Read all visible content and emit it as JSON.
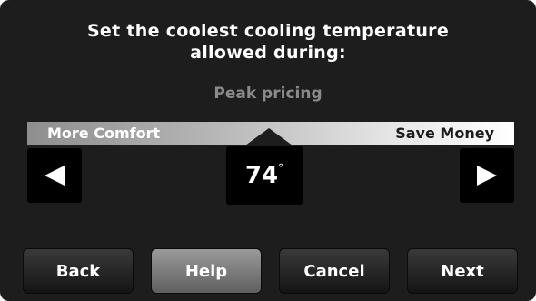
{
  "header": {
    "title_line1": "Set the coolest cooling temperature",
    "title_line2": "allowed during:",
    "subtitle": "Peak pricing"
  },
  "slider": {
    "left_label": "More Comfort",
    "right_label": "Save Money",
    "temperature": "74",
    "unit": "°"
  },
  "buttons": {
    "back": "Back",
    "help": "Help",
    "cancel": "Cancel",
    "next": "Next"
  },
  "colors": {
    "background": "#1d1d1d",
    "dark_button": "#141414",
    "light_button": "#7a7a7a",
    "subtitle": "#8a8a8a"
  },
  "icons": {
    "decrease": "left-arrow-icon",
    "increase": "right-arrow-icon"
  }
}
